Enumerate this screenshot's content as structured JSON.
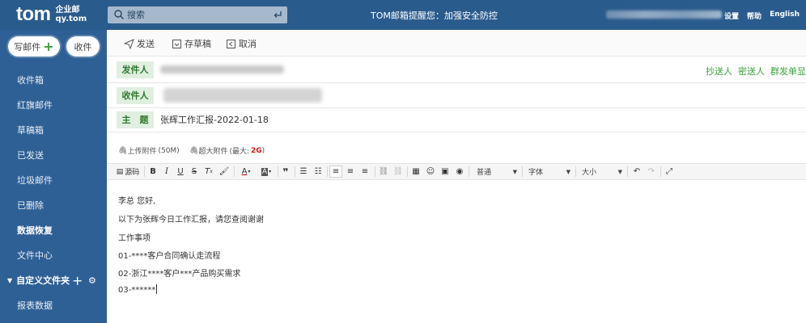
{
  "header": {
    "logo_main": "tom",
    "logo_sub1": "企业邮",
    "logo_sub2": "qy.tom",
    "search_placeholder": "搜索",
    "notice": "TOM邮箱提醒您：加强安全防控",
    "links": [
      "设置",
      "帮助",
      "English"
    ]
  },
  "sidebar": {
    "compose_label": "写邮件",
    "inbox_label": "收件",
    "items": [
      {
        "label": "收件箱",
        "bold": false
      },
      {
        "label": "红旗邮件",
        "bold": false
      },
      {
        "label": "草稿箱",
        "bold": false
      },
      {
        "label": "已发送",
        "bold": false
      },
      {
        "label": "垃圾邮件",
        "bold": false
      },
      {
        "label": "已删除",
        "bold": false
      },
      {
        "label": "数据恢复",
        "bold": true
      },
      {
        "label": "文件中心",
        "bold": false
      }
    ],
    "folder_section": "自定义文件夹",
    "folder_items": [
      "报表数据"
    ]
  },
  "actions": {
    "send": "发送",
    "save_draft": "存草稿",
    "cancel": "取消"
  },
  "compose": {
    "from_label": "发件人",
    "to_label": "收件人",
    "subject_label": "主　题",
    "subject_value": "张辉工作汇报-2022-01-18",
    "cc_links": [
      "抄送人",
      "密送人",
      "群发单显"
    ]
  },
  "attachments": {
    "upload_label": "上传附件",
    "upload_limit": "(50M)",
    "large_label": "超大附件",
    "large_limit_prefix": "(最大:",
    "large_limit_value": "2G",
    "large_limit_suffix": ")"
  },
  "toolbar": {
    "source_label": "源码",
    "paragraph_select": "普通",
    "font_select": "字体",
    "size_select": "大小"
  },
  "body": {
    "lines": [
      "李总 您好,",
      "以下为张辉今日工作汇报，请您查阅谢谢",
      "工作事项",
      "01-****客户合同确认走流程",
      "02-浙江****客户***产品购买需求",
      "03-******"
    ]
  },
  "colors": {
    "topbar": "#2a5b8d",
    "sidebar": "#2e6096",
    "label_bg": "#e0efe0",
    "label_text": "#2f7a2f",
    "accent_green": "#3aa03a"
  }
}
